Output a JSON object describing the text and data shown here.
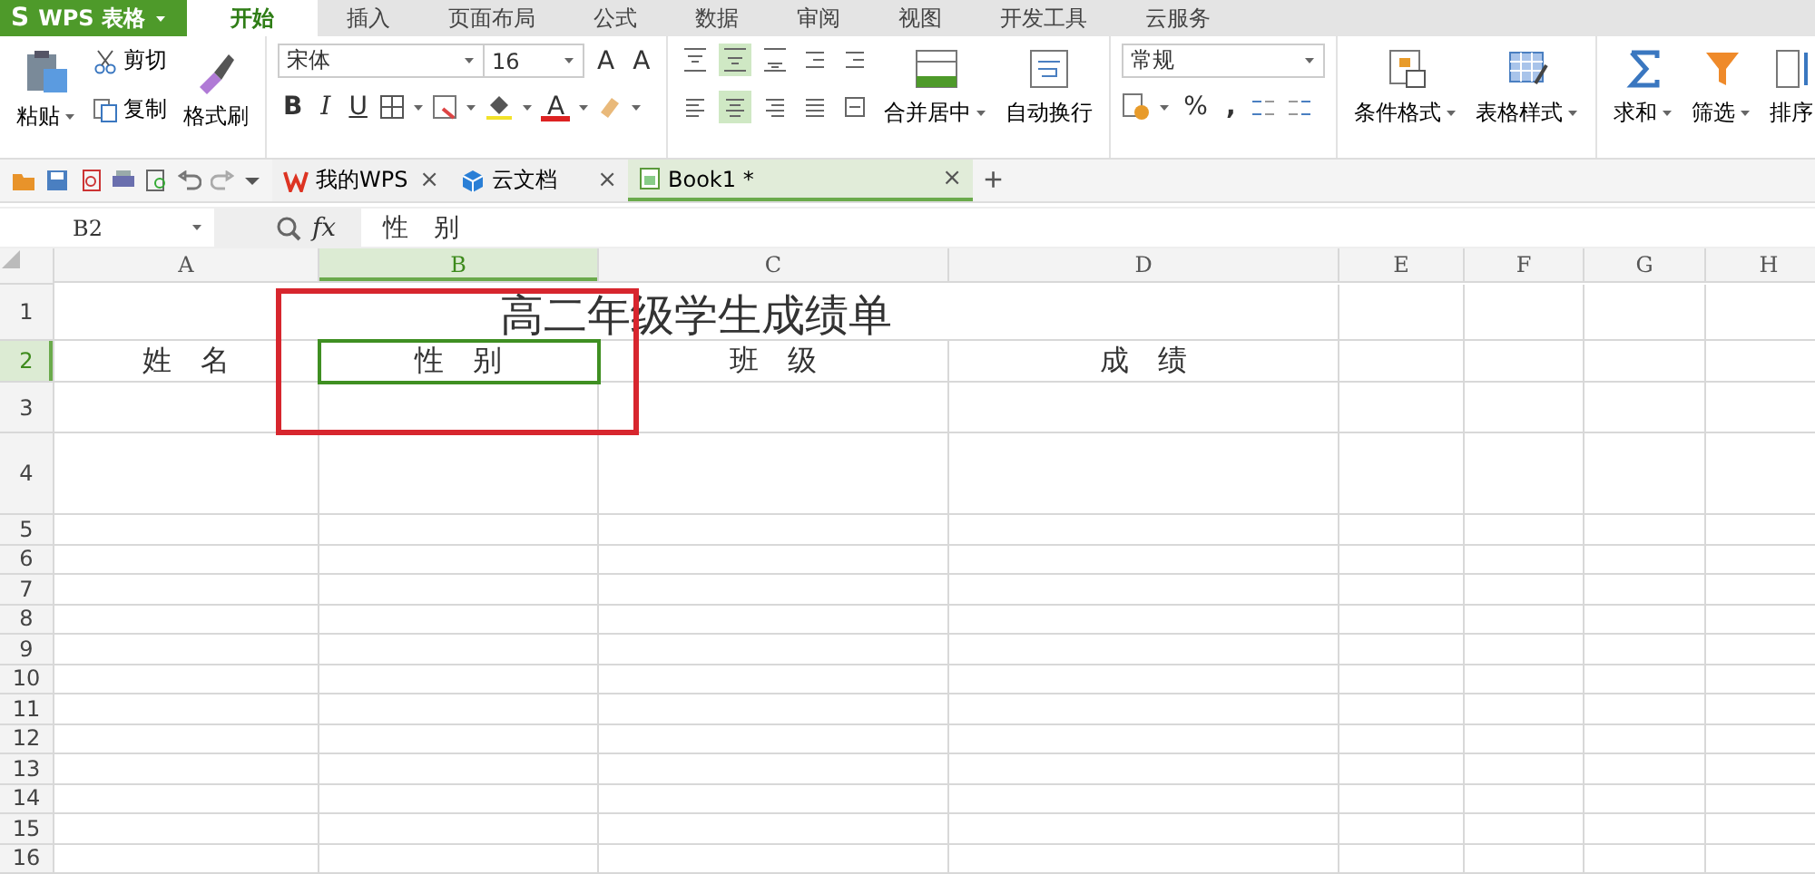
{
  "app_menu": {
    "label": "WPS 表格",
    "logo": "S"
  },
  "menu_tabs": [
    {
      "label": "开始",
      "selected": true
    },
    {
      "label": "插入",
      "selected": false
    },
    {
      "label": "页面布局",
      "selected": false
    },
    {
      "label": "公式",
      "selected": false
    },
    {
      "label": "数据",
      "selected": false
    },
    {
      "label": "审阅",
      "selected": false
    },
    {
      "label": "视图",
      "selected": false
    },
    {
      "label": "开发工具",
      "selected": false
    },
    {
      "label": "云服务",
      "selected": false
    }
  ],
  "ribbon": {
    "clipboard": {
      "paste": "粘贴",
      "cut": "剪切",
      "copy": "复制",
      "format_painter": "格式刷"
    },
    "font": {
      "font_name": "宋体",
      "font_size": "16",
      "grow": "A",
      "shrink": "A",
      "bold": "B",
      "italic": "I",
      "underline": "U",
      "font_color": "A"
    },
    "alignment": {
      "merge": "合并居中",
      "wrap": "自动换行",
      "buttons": [
        {
          "selected": false
        },
        {
          "selected": true
        },
        {
          "selected": false
        },
        {
          "selected": false
        },
        {
          "selected": false
        },
        {
          "selected": false
        },
        {
          "selected": true
        },
        {
          "selected": false
        },
        {
          "selected": false
        },
        {
          "selected": false
        }
      ]
    },
    "number": {
      "format": "常规",
      "percent": "%",
      "comma": ","
    },
    "styles": {
      "conditional": "条件格式",
      "table_style": "表格样式"
    },
    "editing": {
      "sum": "求和",
      "filter": "筛选",
      "sort": "排序"
    }
  },
  "doc_tabs": [
    {
      "label": "我的WPS",
      "kind": "wps",
      "selected": false,
      "close": "×"
    },
    {
      "label": "云文档",
      "kind": "cloud",
      "selected": false,
      "close": "×"
    },
    {
      "label": "Book1 *",
      "kind": "book",
      "selected": true,
      "close": "×"
    }
  ],
  "new_tab": "+",
  "formula_bar": {
    "name_box": "B2",
    "fx": "fx",
    "value": "性　别"
  },
  "columns": [
    {
      "label": "A",
      "selected": false
    },
    {
      "label": "B",
      "selected": true
    },
    {
      "label": "C",
      "selected": false
    },
    {
      "label": "D",
      "selected": false
    },
    {
      "label": "E",
      "selected": false
    },
    {
      "label": "F",
      "selected": false
    },
    {
      "label": "G",
      "selected": false
    },
    {
      "label": "H",
      "selected": false
    }
  ],
  "rows": [
    {
      "label": "1",
      "selected": false,
      "kind": "title",
      "title": "高二年级学生成绩单"
    },
    {
      "label": "2",
      "selected": true,
      "kind": "cells",
      "cells": [
        {
          "text": "姓　名",
          "selected": false
        },
        {
          "text": "性　别",
          "selected": true
        },
        {
          "text": "班　级",
          "selected": false
        },
        {
          "text": "成　绩",
          "selected": false
        }
      ]
    },
    {
      "label": "3",
      "selected": false
    },
    {
      "label": "4",
      "selected": false
    },
    {
      "label": "5",
      "selected": false
    },
    {
      "label": "6",
      "selected": false
    },
    {
      "label": "7",
      "selected": false
    },
    {
      "label": "8",
      "selected": false
    },
    {
      "label": "9",
      "selected": false
    },
    {
      "label": "10",
      "selected": false
    },
    {
      "label": "11",
      "selected": false
    },
    {
      "label": "12",
      "selected": false
    },
    {
      "label": "13",
      "selected": false
    },
    {
      "label": "14",
      "selected": false
    },
    {
      "label": "15",
      "selected": false
    },
    {
      "label": "16",
      "selected": false
    }
  ]
}
